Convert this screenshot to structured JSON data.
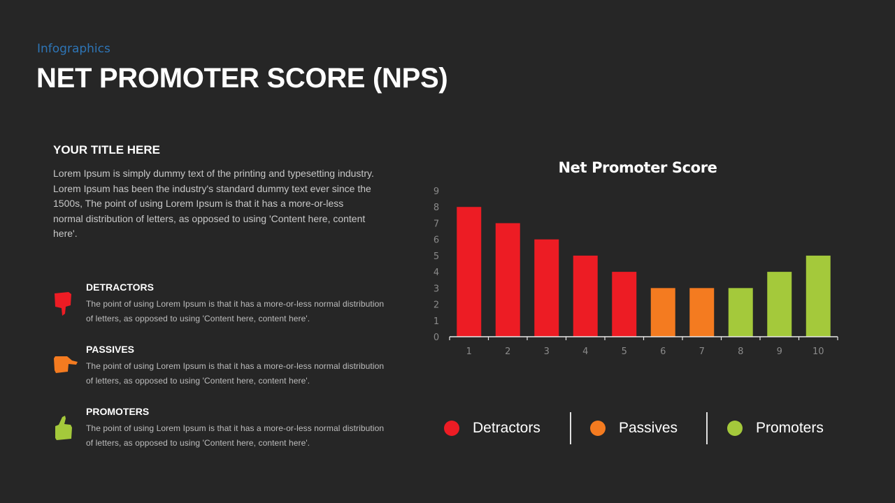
{
  "header": {
    "eyebrow": "Infographics",
    "title": "NET PROMOTER SCORE (NPS)"
  },
  "intro": {
    "title": "YOUR TITLE HERE",
    "body": "Lorem Ipsum is simply dummy text of the printing and typesetting industry. Lorem Ipsum has been the industry's standard dummy text ever since the 1500s, The point of using Lorem Ipsum is that it has a more-or-less normal distribution of letters, as opposed to using 'Content here, content here'."
  },
  "categories": [
    {
      "title": "DETRACTORS",
      "icon": "thumbs-down-icon",
      "color": "#ed1c24",
      "body": "The point of using Lorem Ipsum is that it has a more-or-less  normal distribution of letters, as opposed to using 'Content here, content here'."
    },
    {
      "title": "PASSIVES",
      "icon": "pointing-hand-icon",
      "color": "#f47b20",
      "body": "The point of using Lorem Ipsum is that it has a more-or-less  normal distribution of letters, as opposed to using 'Content here, content here'."
    },
    {
      "title": "PROMOTERS",
      "icon": "thumbs-up-icon",
      "color": "#a4c93b",
      "body": "The point of using Lorem Ipsum is that it has a more-or-less  normal distribution of letters, as opposed to using 'Content here, content here'."
    }
  ],
  "chart_data": {
    "type": "bar",
    "title": "Net Promoter Score",
    "xlabel": "",
    "ylabel": "",
    "categories": [
      "1",
      "2",
      "3",
      "4",
      "5",
      "6",
      "7",
      "8",
      "9",
      "10"
    ],
    "values": [
      8,
      7,
      6,
      5,
      4,
      3,
      3,
      3,
      4,
      5
    ],
    "bar_groups": [
      "Detractors",
      "Detractors",
      "Detractors",
      "Detractors",
      "Detractors",
      "Passives",
      "Passives",
      "Promoters",
      "Promoters",
      "Promoters"
    ],
    "yticks": [
      0,
      1,
      2,
      3,
      4,
      5,
      6,
      7,
      8,
      9
    ],
    "ylim": [
      0,
      9
    ],
    "grid": false,
    "legend": {
      "placement": "bottom",
      "entries": [
        {
          "name": "Detractors",
          "color": "#ed1c24"
        },
        {
          "name": "Passives",
          "color": "#f47b20"
        },
        {
          "name": "Promoters",
          "color": "#a4c93b"
        }
      ]
    }
  }
}
